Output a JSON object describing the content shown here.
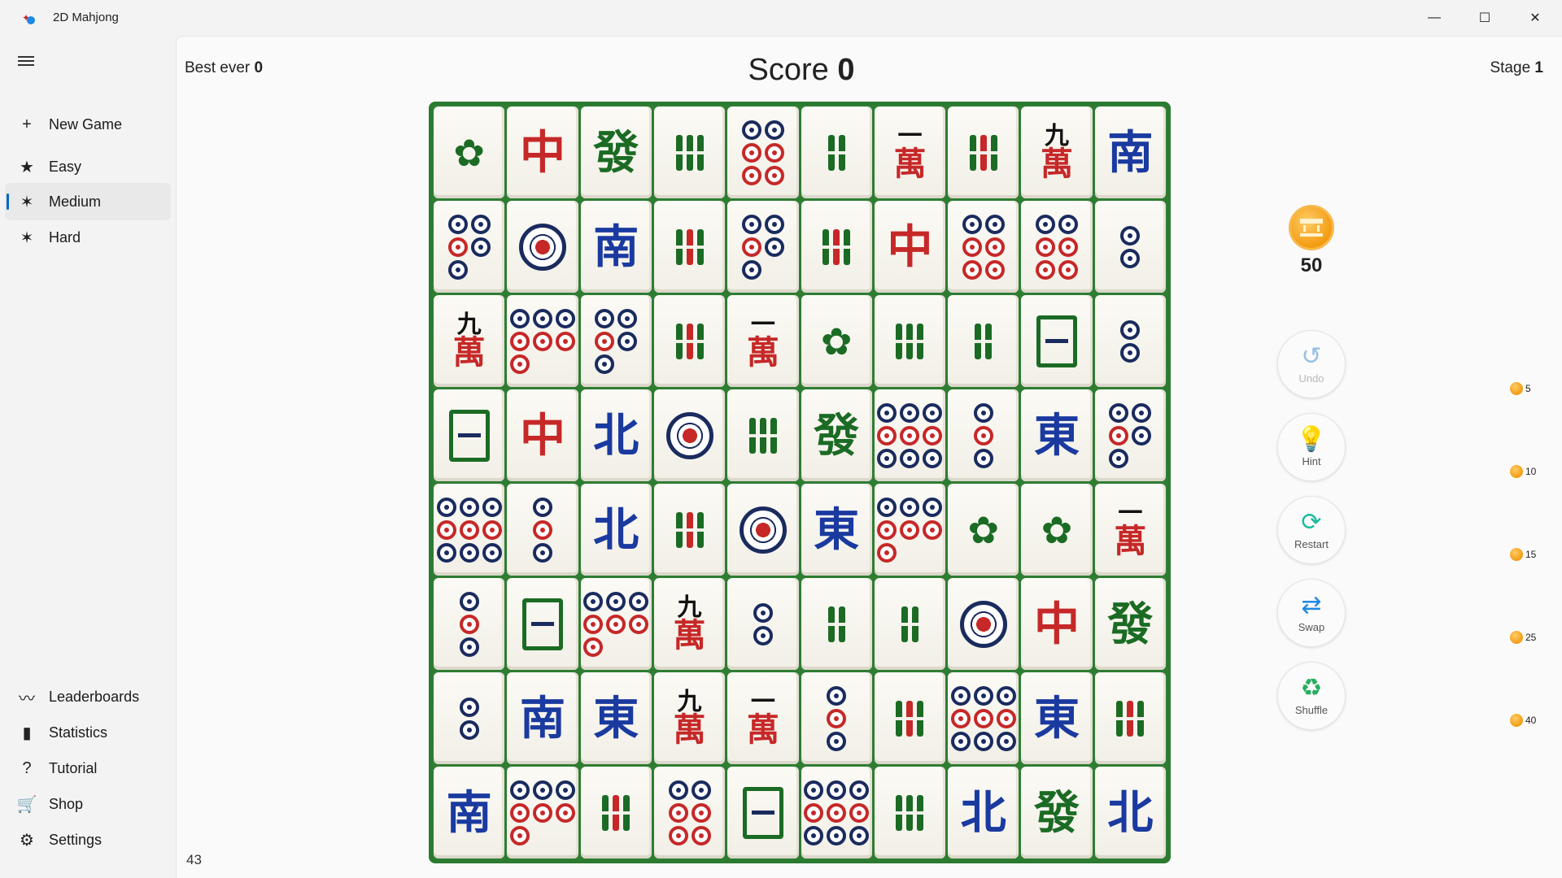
{
  "app": {
    "title": "2D Mahjong",
    "icon": "mahjong-app-icon"
  },
  "window_controls": {
    "minimize": "—",
    "maximize": "☐",
    "close": "✕"
  },
  "sidebar": {
    "menu_icon": "hamburger-icon",
    "items_top": [
      {
        "id": "new-game",
        "label": "New Game",
        "icon": "+"
      },
      {
        "id": "easy",
        "label": "Easy",
        "icon": "★"
      },
      {
        "id": "medium",
        "label": "Medium",
        "icon": "✶",
        "active": true
      },
      {
        "id": "hard",
        "label": "Hard",
        "icon": "✶"
      }
    ],
    "items_bottom": [
      {
        "id": "leaderboards",
        "label": "Leaderboards",
        "icon": "〰"
      },
      {
        "id": "statistics",
        "label": "Statistics",
        "icon": "▮"
      },
      {
        "id": "tutorial",
        "label": "Tutorial",
        "icon": "?"
      },
      {
        "id": "shop",
        "label": "Shop",
        "icon": "🛒"
      },
      {
        "id": "settings",
        "label": "Settings",
        "icon": "⚙"
      }
    ]
  },
  "header": {
    "best_label": "Best ever",
    "best_value": "0",
    "score_label": "Score",
    "score_value": "0",
    "stage_label": "Stage",
    "stage_value": "1"
  },
  "tiles_remaining": "43",
  "coins": {
    "count": "50"
  },
  "powerups": [
    {
      "id": "undo",
      "label": "Undo",
      "icon": "↺",
      "cost": "5",
      "color": "#0067c0",
      "disabled": true
    },
    {
      "id": "hint",
      "label": "Hint",
      "icon": "💡",
      "cost": "10",
      "color": "#f1c40f",
      "disabled": false
    },
    {
      "id": "restart",
      "label": "Restart",
      "icon": "⟳",
      "cost": "15",
      "color": "#1abc9c",
      "disabled": false
    },
    {
      "id": "swap",
      "label": "Swap",
      "icon": "⇄",
      "cost": "25",
      "color": "#1e88e5",
      "disabled": false
    },
    {
      "id": "shuffle",
      "label": "Shuffle",
      "icon": "♻",
      "cost": "40",
      "color": "#27ae60",
      "disabled": false
    }
  ],
  "board": {
    "rows": [
      [
        {
          "t": "bird"
        },
        {
          "t": "glyph",
          "ch": "中",
          "c": "red"
        },
        {
          "t": "glyph",
          "ch": "發",
          "c": "green"
        },
        {
          "t": "bam",
          "n": 3
        },
        {
          "t": "dots",
          "n": 6
        },
        {
          "t": "bam",
          "n": 2
        },
        {
          "t": "char",
          "top": "一"
        },
        {
          "t": "bam",
          "n": 7
        },
        {
          "t": "char",
          "top": "九"
        },
        {
          "t": "glyph",
          "ch": "南",
          "c": "blue"
        }
      ],
      [
        {
          "t": "dots",
          "n": 5
        },
        {
          "t": "big"
        },
        {
          "t": "glyph",
          "ch": "南",
          "c": "blue"
        },
        {
          "t": "bam",
          "n": 9
        },
        {
          "t": "dots",
          "n": 5
        },
        {
          "t": "bam",
          "n": 9
        },
        {
          "t": "glyph",
          "ch": "中",
          "c": "red"
        },
        {
          "t": "dots",
          "n": 6
        },
        {
          "t": "dots",
          "n": 6
        },
        {
          "t": "dots",
          "n": 2
        }
      ],
      [
        {
          "t": "char",
          "top": "九"
        },
        {
          "t": "dots",
          "n": 7
        },
        {
          "t": "dots",
          "n": 5
        },
        {
          "t": "bam",
          "n": 7
        },
        {
          "t": "char",
          "top": "一"
        },
        {
          "t": "bird"
        },
        {
          "t": "bam",
          "n": 3
        },
        {
          "t": "bam",
          "n": 2
        },
        {
          "t": "frame"
        },
        {
          "t": "dots",
          "n": 2
        }
      ],
      [
        {
          "t": "frame"
        },
        {
          "t": "glyph",
          "ch": "中",
          "c": "red"
        },
        {
          "t": "glyph",
          "ch": "北",
          "c": "blue"
        },
        {
          "t": "big"
        },
        {
          "t": "bam",
          "n": 3
        },
        {
          "t": "glyph",
          "ch": "發",
          "c": "green"
        },
        {
          "t": "dots",
          "n": 9
        },
        {
          "t": "dots",
          "n": 3
        },
        {
          "t": "glyph",
          "ch": "東",
          "c": "blue"
        },
        {
          "t": "dots",
          "n": 5
        }
      ],
      [
        {
          "t": "dots",
          "n": 9
        },
        {
          "t": "dots",
          "n": 3
        },
        {
          "t": "glyph",
          "ch": "北",
          "c": "blue"
        },
        {
          "t": "bam",
          "n": 9
        },
        {
          "t": "big"
        },
        {
          "t": "glyph",
          "ch": "東",
          "c": "blue"
        },
        {
          "t": "dots",
          "n": 7
        },
        {
          "t": "bird"
        },
        {
          "t": "bird"
        },
        {
          "t": "char",
          "top": "一"
        }
      ],
      [
        {
          "t": "dots",
          "n": 3
        },
        {
          "t": "frame"
        },
        {
          "t": "dots",
          "n": 7
        },
        {
          "t": "char",
          "top": "九"
        },
        {
          "t": "dots",
          "n": 2
        },
        {
          "t": "bam",
          "n": 2
        },
        {
          "t": "bam",
          "n": 2
        },
        {
          "t": "big"
        },
        {
          "t": "glyph",
          "ch": "中",
          "c": "red"
        },
        {
          "t": "glyph",
          "ch": "發",
          "c": "green"
        }
      ],
      [
        {
          "t": "dots",
          "n": 2
        },
        {
          "t": "glyph",
          "ch": "南",
          "c": "blue"
        },
        {
          "t": "glyph",
          "ch": "東",
          "c": "blue"
        },
        {
          "t": "char",
          "top": "九"
        },
        {
          "t": "char",
          "top": "一"
        },
        {
          "t": "dots",
          "n": 3
        },
        {
          "t": "bam",
          "n": 7
        },
        {
          "t": "dots",
          "n": 9
        },
        {
          "t": "glyph",
          "ch": "東",
          "c": "blue"
        },
        {
          "t": "bam",
          "n": 7
        }
      ],
      [
        {
          "t": "glyph",
          "ch": "南",
          "c": "blue"
        },
        {
          "t": "dots",
          "n": 7
        },
        {
          "t": "bam",
          "n": 9
        },
        {
          "t": "dots",
          "n": 6
        },
        {
          "t": "frame"
        },
        {
          "t": "dots",
          "n": 9
        },
        {
          "t": "bam",
          "n": 3
        },
        {
          "t": "glyph",
          "ch": "北",
          "c": "blue"
        },
        {
          "t": "glyph",
          "ch": "發",
          "c": "green"
        },
        {
          "t": "glyph",
          "ch": "北",
          "c": "blue"
        }
      ]
    ],
    "char_bottom": "萬"
  }
}
